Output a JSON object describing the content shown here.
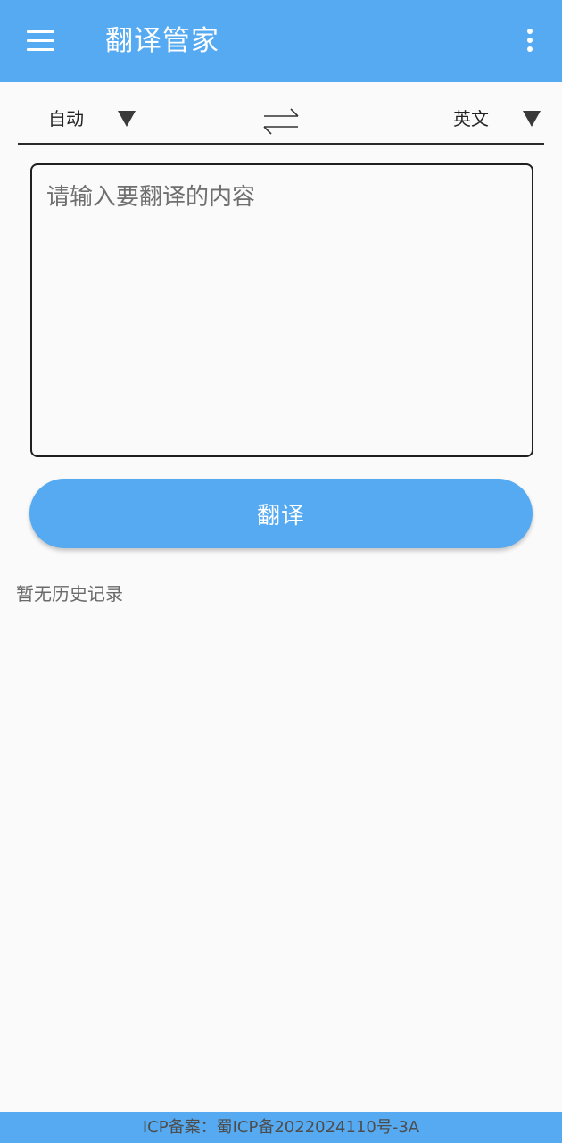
{
  "app_bar": {
    "title": "翻译管家",
    "menu_icon": "hamburger-menu-icon",
    "more_icon": "more-vertical-icon",
    "color": "#55AAF2"
  },
  "languages": {
    "source": "自动",
    "target": "英文",
    "dropdown_icon": "triangle-down-icon",
    "swap_icon": "swap-arrows-icon"
  },
  "input": {
    "placeholder": "请输入要翻译的内容",
    "value": ""
  },
  "translate_button": {
    "label": "翻译"
  },
  "history": {
    "empty_text": "暂无历史记录"
  },
  "footer": {
    "icp_text": "ICP备案：蜀ICP备2022024110号-3A"
  }
}
